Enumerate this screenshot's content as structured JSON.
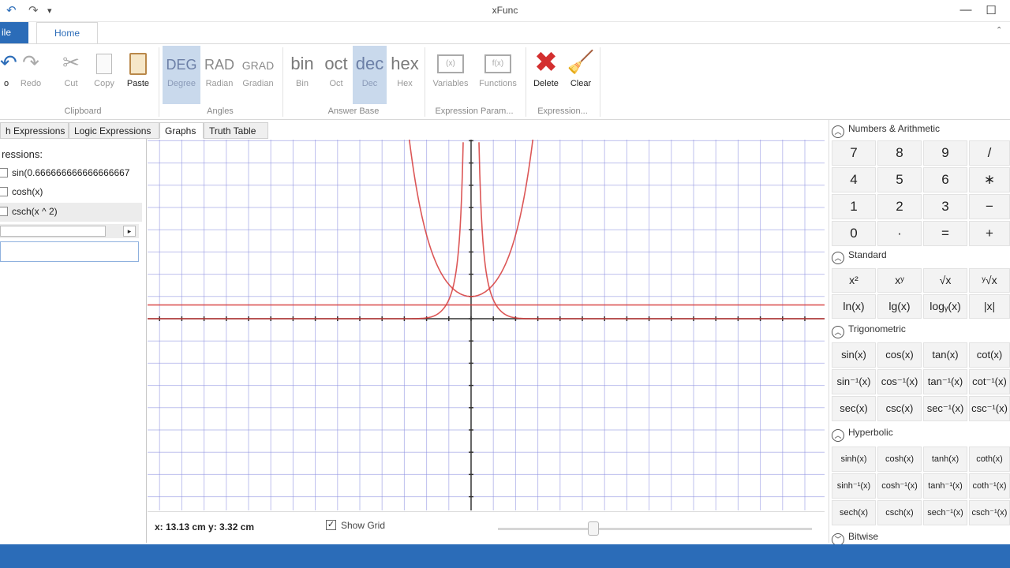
{
  "app": {
    "title": "xFunc"
  },
  "colors": {
    "accent": "#2b6cb8",
    "selected": "#c9d9ec",
    "grid": "#8a8ee0",
    "curve": "#d63a3a",
    "axis": "#333333"
  },
  "quick_access": {
    "undo_icon": "undo-icon",
    "redo_icon": "redo-icon",
    "customize": "▾"
  },
  "window": {
    "minimize": "—",
    "maximize": "☐"
  },
  "tabs": {
    "file": "ile",
    "home": "Home"
  },
  "ribbon": {
    "clipboard": {
      "label": "Clipboard",
      "undo": "o",
      "redo": "Redo",
      "cut": "Cut",
      "copy": "Copy",
      "paste": "Paste"
    },
    "angles": {
      "label": "Angles",
      "deg_big": "DEG",
      "deg": "Degree",
      "rad_big": "RAD",
      "rad": "Radian",
      "grad_big": "GRAD",
      "grad": "Gradian"
    },
    "answer_base": {
      "label": "Answer Base",
      "bin_big": "bin",
      "bin": "Bin",
      "oct_big": "oct",
      "oct": "Oct",
      "dec_big": "dec",
      "dec": "Dec",
      "hex_big": "hex",
      "hex": "Hex"
    },
    "expression_params": {
      "label": "Expression Param...",
      "variables": "Variables",
      "functions": "Functions",
      "var_icon": "(x)",
      "fn_icon": "f(x)"
    },
    "expression": {
      "label": "Expression...",
      "delete": "Delete",
      "clear": "Clear"
    }
  },
  "expr_tabs": [
    "h Expressions",
    "Logic Expressions",
    "Graphs",
    "Truth Table"
  ],
  "left": {
    "header": "ressions:",
    "items": [
      "sin(0.666666666666666667",
      "cosh(x)",
      "csch(x ^ 2)"
    ],
    "spin": "▸"
  },
  "graph": {
    "coords": "x: 13.13 cm y: 3.32 cm",
    "show_grid_label": "Show Grid",
    "show_grid": true
  },
  "keypad": {
    "numbers": {
      "title": "Numbers & Arithmetic",
      "keys": [
        "7",
        "8",
        "9",
        "/",
        "4",
        "5",
        "6",
        "∗",
        "1",
        "2",
        "3",
        "−",
        "0",
        "·",
        "=",
        "+"
      ]
    },
    "standard": {
      "title": "Standard",
      "keys": [
        "x²",
        "xʸ",
        "√x",
        "ʸ√x",
        "ln(x)",
        "lg(x)",
        "logᵧ(x)",
        "|x|"
      ]
    },
    "trig": {
      "title": "Trigonometric",
      "keys": [
        "sin(x)",
        "cos(x)",
        "tan(x)",
        "cot(x)",
        "sin⁻¹(x)",
        "cos⁻¹(x)",
        "tan⁻¹(x)",
        "cot⁻¹(x)",
        "sec(x)",
        "csc(x)",
        "sec⁻¹(x)",
        "csc⁻¹(x)"
      ]
    },
    "hyper": {
      "title": "Hyperbolic",
      "keys": [
        "sinh(x)",
        "cosh(x)",
        "tanh(x)",
        "coth(x)",
        "sinh⁻¹(x)",
        "cosh⁻¹(x)",
        "tanh⁻¹(x)",
        "coth⁻¹(x)",
        "sech(x)",
        "csch(x)",
        "sech⁻¹(x)",
        "csch⁻¹(x)"
      ]
    },
    "bitwise": {
      "title": "Bitwise"
    }
  }
}
